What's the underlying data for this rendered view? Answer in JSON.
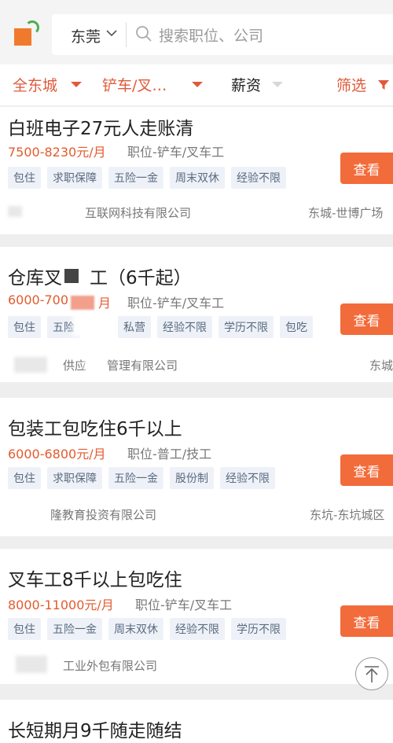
{
  "header": {
    "city": "东莞",
    "search_placeholder": "搜索职位、公司"
  },
  "filters": [
    {
      "label": "全东城",
      "active": true
    },
    {
      "label": "铲车/叉…",
      "active": true
    },
    {
      "label": "薪资",
      "active": false
    },
    {
      "label": "筛选",
      "active": true
    }
  ],
  "jobs": [
    {
      "title": "白班电子27元人走账清",
      "salary": "7500-8230元/月",
      "position": "职位-铲车/叉车工",
      "tags": [
        "包住",
        "求职保障",
        "五险一金",
        "周末双休",
        "经验不限"
      ],
      "button": "查看",
      "company": "互联网科技有限公司",
      "location": "东城-世博广场"
    },
    {
      "title": "仓库叉",
      "title_tail": "工（6千起）",
      "salary": "6000-700",
      "salary_tail": "月",
      "position": "职位-铲车/叉车工",
      "tags": [
        "包住",
        "五险",
        "私营",
        "经验不限",
        "学历不限",
        "包吃"
      ],
      "button": "查看",
      "company_a": "供应",
      "company_b": "管理有限公司",
      "location": "东城"
    },
    {
      "title": "包装工包吃住6千以上",
      "salary": "6000-6800元/月",
      "position": "职位-普工/技工",
      "tags": [
        "包住",
        "求职保障",
        "五险一金",
        "股份制",
        "经验不限"
      ],
      "button": "查看",
      "company": "隆教育投资有限公司",
      "location": "东坑-东坑城区"
    },
    {
      "title": "叉车工8千以上包吃住",
      "salary": "8000-11000元/月",
      "position": "职位-铲车/叉车工",
      "tags": [
        "包住",
        "五险一金",
        "周末双休",
        "经验不限",
        "学历不限"
      ],
      "button": "查看",
      "company": "工业外包有限公司",
      "location": ""
    },
    {
      "title": "长短期月9千随走随结"
    }
  ],
  "colors": {
    "accent": "#f26b3a",
    "salary": "#e35b2e",
    "tag_bg": "#eef2f8",
    "tag_text": "#5a6a80"
  }
}
